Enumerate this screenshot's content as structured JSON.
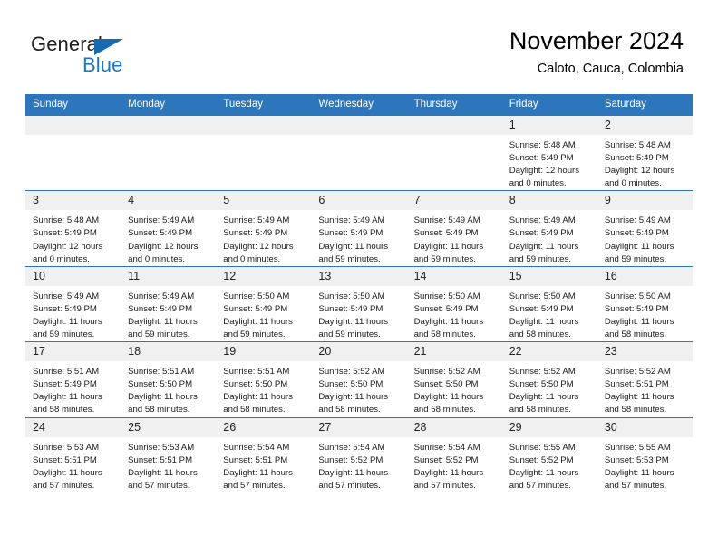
{
  "brand": {
    "name_part1": "General",
    "name_part2": "Blue",
    "accent_color": "#1a77c4",
    "triangle_color": "#1769b0"
  },
  "header": {
    "title": "November 2024",
    "subtitle": "Caloto, Cauca, Colombia"
  },
  "calendar": {
    "header_bg": "#2e76bc",
    "daynum_bg": "#f0f0f0",
    "weekdays": [
      "Sunday",
      "Monday",
      "Tuesday",
      "Wednesday",
      "Thursday",
      "Friday",
      "Saturday"
    ],
    "weeks": [
      [
        {
          "day": "",
          "empty": true
        },
        {
          "day": "",
          "empty": true
        },
        {
          "day": "",
          "empty": true
        },
        {
          "day": "",
          "empty": true
        },
        {
          "day": "",
          "empty": true
        },
        {
          "day": "1",
          "sunrise": "Sunrise: 5:48 AM",
          "sunset": "Sunset: 5:49 PM",
          "daylight": "Daylight: 12 hours and 0 minutes."
        },
        {
          "day": "2",
          "sunrise": "Sunrise: 5:48 AM",
          "sunset": "Sunset: 5:49 PM",
          "daylight": "Daylight: 12 hours and 0 minutes."
        }
      ],
      [
        {
          "day": "3",
          "sunrise": "Sunrise: 5:48 AM",
          "sunset": "Sunset: 5:49 PM",
          "daylight": "Daylight: 12 hours and 0 minutes."
        },
        {
          "day": "4",
          "sunrise": "Sunrise: 5:49 AM",
          "sunset": "Sunset: 5:49 PM",
          "daylight": "Daylight: 12 hours and 0 minutes."
        },
        {
          "day": "5",
          "sunrise": "Sunrise: 5:49 AM",
          "sunset": "Sunset: 5:49 PM",
          "daylight": "Daylight: 12 hours and 0 minutes."
        },
        {
          "day": "6",
          "sunrise": "Sunrise: 5:49 AM",
          "sunset": "Sunset: 5:49 PM",
          "daylight": "Daylight: 11 hours and 59 minutes."
        },
        {
          "day": "7",
          "sunrise": "Sunrise: 5:49 AM",
          "sunset": "Sunset: 5:49 PM",
          "daylight": "Daylight: 11 hours and 59 minutes."
        },
        {
          "day": "8",
          "sunrise": "Sunrise: 5:49 AM",
          "sunset": "Sunset: 5:49 PM",
          "daylight": "Daylight: 11 hours and 59 minutes."
        },
        {
          "day": "9",
          "sunrise": "Sunrise: 5:49 AM",
          "sunset": "Sunset: 5:49 PM",
          "daylight": "Daylight: 11 hours and 59 minutes."
        }
      ],
      [
        {
          "day": "10",
          "sunrise": "Sunrise: 5:49 AM",
          "sunset": "Sunset: 5:49 PM",
          "daylight": "Daylight: 11 hours and 59 minutes."
        },
        {
          "day": "11",
          "sunrise": "Sunrise: 5:49 AM",
          "sunset": "Sunset: 5:49 PM",
          "daylight": "Daylight: 11 hours and 59 minutes."
        },
        {
          "day": "12",
          "sunrise": "Sunrise: 5:50 AM",
          "sunset": "Sunset: 5:49 PM",
          "daylight": "Daylight: 11 hours and 59 minutes."
        },
        {
          "day": "13",
          "sunrise": "Sunrise: 5:50 AM",
          "sunset": "Sunset: 5:49 PM",
          "daylight": "Daylight: 11 hours and 59 minutes."
        },
        {
          "day": "14",
          "sunrise": "Sunrise: 5:50 AM",
          "sunset": "Sunset: 5:49 PM",
          "daylight": "Daylight: 11 hours and 58 minutes."
        },
        {
          "day": "15",
          "sunrise": "Sunrise: 5:50 AM",
          "sunset": "Sunset: 5:49 PM",
          "daylight": "Daylight: 11 hours and 58 minutes."
        },
        {
          "day": "16",
          "sunrise": "Sunrise: 5:50 AM",
          "sunset": "Sunset: 5:49 PM",
          "daylight": "Daylight: 11 hours and 58 minutes."
        }
      ],
      [
        {
          "day": "17",
          "sunrise": "Sunrise: 5:51 AM",
          "sunset": "Sunset: 5:49 PM",
          "daylight": "Daylight: 11 hours and 58 minutes."
        },
        {
          "day": "18",
          "sunrise": "Sunrise: 5:51 AM",
          "sunset": "Sunset: 5:50 PM",
          "daylight": "Daylight: 11 hours and 58 minutes."
        },
        {
          "day": "19",
          "sunrise": "Sunrise: 5:51 AM",
          "sunset": "Sunset: 5:50 PM",
          "daylight": "Daylight: 11 hours and 58 minutes."
        },
        {
          "day": "20",
          "sunrise": "Sunrise: 5:52 AM",
          "sunset": "Sunset: 5:50 PM",
          "daylight": "Daylight: 11 hours and 58 minutes."
        },
        {
          "day": "21",
          "sunrise": "Sunrise: 5:52 AM",
          "sunset": "Sunset: 5:50 PM",
          "daylight": "Daylight: 11 hours and 58 minutes."
        },
        {
          "day": "22",
          "sunrise": "Sunrise: 5:52 AM",
          "sunset": "Sunset: 5:50 PM",
          "daylight": "Daylight: 11 hours and 58 minutes."
        },
        {
          "day": "23",
          "sunrise": "Sunrise: 5:52 AM",
          "sunset": "Sunset: 5:51 PM",
          "daylight": "Daylight: 11 hours and 58 minutes."
        }
      ],
      [
        {
          "day": "24",
          "sunrise": "Sunrise: 5:53 AM",
          "sunset": "Sunset: 5:51 PM",
          "daylight": "Daylight: 11 hours and 57 minutes."
        },
        {
          "day": "25",
          "sunrise": "Sunrise: 5:53 AM",
          "sunset": "Sunset: 5:51 PM",
          "daylight": "Daylight: 11 hours and 57 minutes."
        },
        {
          "day": "26",
          "sunrise": "Sunrise: 5:54 AM",
          "sunset": "Sunset: 5:51 PM",
          "daylight": "Daylight: 11 hours and 57 minutes."
        },
        {
          "day": "27",
          "sunrise": "Sunrise: 5:54 AM",
          "sunset": "Sunset: 5:52 PM",
          "daylight": "Daylight: 11 hours and 57 minutes."
        },
        {
          "day": "28",
          "sunrise": "Sunrise: 5:54 AM",
          "sunset": "Sunset: 5:52 PM",
          "daylight": "Daylight: 11 hours and 57 minutes."
        },
        {
          "day": "29",
          "sunrise": "Sunrise: 5:55 AM",
          "sunset": "Sunset: 5:52 PM",
          "daylight": "Daylight: 11 hours and 57 minutes."
        },
        {
          "day": "30",
          "sunrise": "Sunrise: 5:55 AM",
          "sunset": "Sunset: 5:53 PM",
          "daylight": "Daylight: 11 hours and 57 minutes."
        }
      ]
    ]
  }
}
